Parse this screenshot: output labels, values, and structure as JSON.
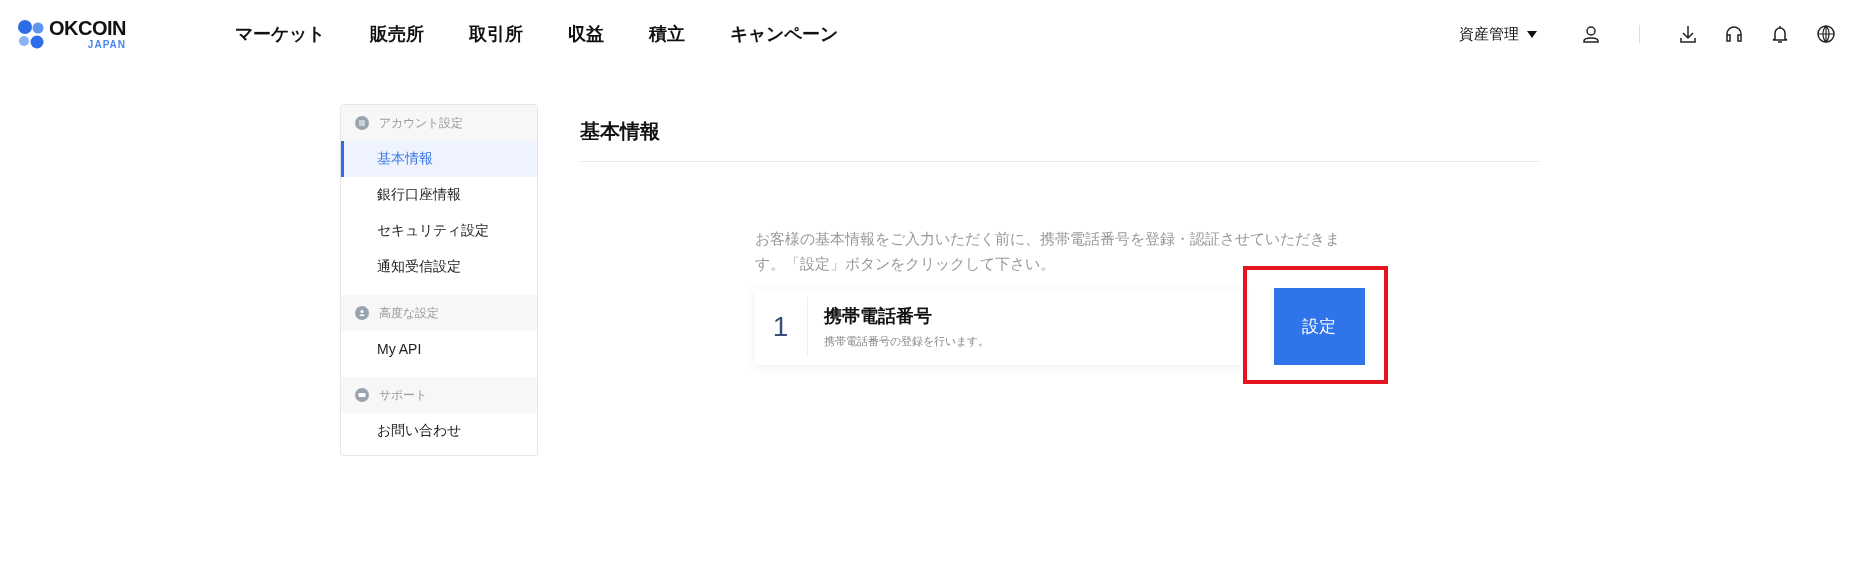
{
  "logo": {
    "name": "OKCOIN",
    "sub": "JAPAN"
  },
  "nav": [
    {
      "label": "マーケット"
    },
    {
      "label": "販売所"
    },
    {
      "label": "取引所"
    },
    {
      "label": "収益"
    },
    {
      "label": "積立"
    },
    {
      "label": "キャンペーン"
    }
  ],
  "header_right": {
    "asset_menu": "資産管理"
  },
  "sidebar": {
    "groups": [
      {
        "title": "アカウント設定",
        "kind": "list",
        "items": [
          {
            "label": "基本情報",
            "selected": true
          },
          {
            "label": "銀行口座情報",
            "selected": false
          },
          {
            "label": "セキュリティ設定",
            "selected": false
          },
          {
            "label": "通知受信設定",
            "selected": false
          }
        ]
      },
      {
        "title": "高度な設定",
        "kind": "person",
        "items": [
          {
            "label": "My API",
            "selected": false
          }
        ]
      },
      {
        "title": "サポート",
        "kind": "chat",
        "items": [
          {
            "label": "お問い合わせ",
            "selected": false
          }
        ]
      }
    ]
  },
  "main": {
    "title": "基本情報",
    "description": "お客様の基本情報をご入力いただく前に、携帯電話番号を登録・認証させていただきます。「設定」ボタンをクリックして下さい。",
    "steps": [
      {
        "number": "1",
        "title": "携帯電話番号",
        "subtitle": "携帯電話番号の登録を行います。",
        "button": "設定",
        "highlighted": true
      }
    ]
  }
}
